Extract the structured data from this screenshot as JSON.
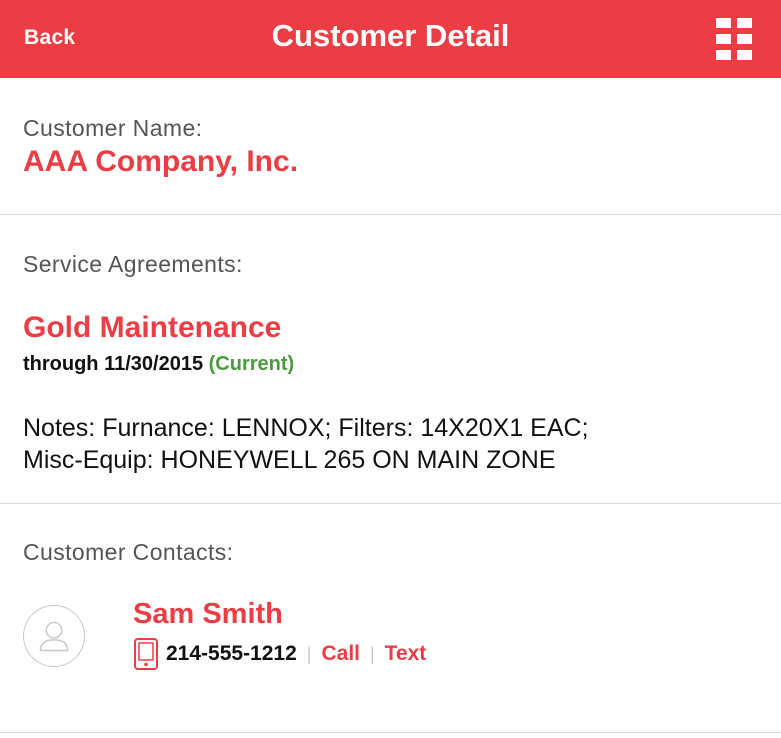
{
  "header": {
    "back_label": "Back",
    "title": "Customer Detail",
    "menu_icon": "grid-menu-icon"
  },
  "customer": {
    "name_label": "Customer Name:",
    "name": "AAA Company, Inc."
  },
  "agreements": {
    "label": "Service Agreements:",
    "plan": "Gold Maintenance",
    "through": "through 11/30/2015",
    "status": "(Current)",
    "notes_line1": "Notes: Furnance: LENNOX; Filters: 14X20X1 EAC;",
    "notes_line2": "Misc-Equip: HONEYWELL 265 ON MAIN ZONE"
  },
  "contacts": {
    "label": "Customer Contacts:",
    "items": [
      {
        "name": "Sam Smith",
        "phone": "214-555-1212",
        "call_label": "Call",
        "text_label": "Text",
        "avatar_icon": "person-avatar-icon",
        "phone_icon": "mobile-phone-icon"
      }
    ]
  },
  "colors": {
    "accent": "#ec3d45",
    "status_current": "#4a9a3e"
  }
}
